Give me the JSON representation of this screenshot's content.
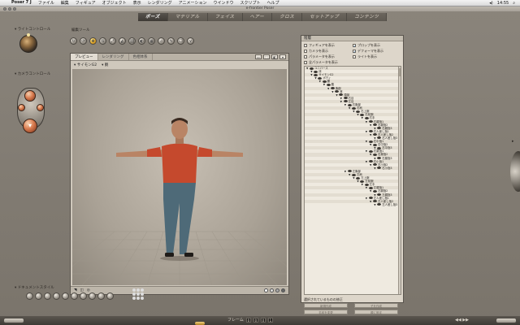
{
  "menubar": {
    "items": [
      "Poser 7 J",
      "ファイル",
      "編集",
      "フィギュア",
      "オブジェクト",
      "表示",
      "レンダリング",
      "アニメーション",
      "ウインドウ",
      "スクリプト",
      "ヘルプ"
    ],
    "time": "14:55"
  },
  "window": {
    "title": "e-frontier Poser"
  },
  "room_tabs": [
    "ポーズ",
    "マテリアル",
    "フェイス",
    "ヘアー",
    "クロス",
    "セットアップ",
    "コンテンツ"
  ],
  "left_panel": {
    "light_controls_label": "ライトコントロール",
    "camera_controls_label": "カメラコントロール",
    "document_display_label": "ドキュメントスタイル"
  },
  "editing_tools_label": "編集ツール",
  "document": {
    "tabs": [
      "プレビュー",
      "レンダリング",
      "色相体系"
    ],
    "figure_select": "サイモンG2",
    "body_part_select": "胴"
  },
  "hierarchy": {
    "title": "階層",
    "options": [
      {
        "label": "フィギュアを表示",
        "checked": false
      },
      {
        "label": "プロップを表示",
        "checked": true
      },
      {
        "label": "カメラを表示",
        "checked": false
      },
      {
        "label": "デフォーマを表示",
        "checked": true
      },
      {
        "label": "パラメータを表示",
        "checked": false
      },
      {
        "label": "ライトを表示",
        "checked": false
      },
      {
        "label": "全パラメータを表示",
        "checked": false
      }
    ],
    "tree": [
      {
        "label": "ユニバース",
        "depth": 0
      },
      {
        "label": "床",
        "depth": 1
      },
      {
        "label": "サイモンG2",
        "depth": 1
      },
      {
        "label": "ボディ",
        "depth": 2
      },
      {
        "label": "腰",
        "depth": 3
      },
      {
        "label": "腹",
        "depth": 4
      },
      {
        "label": "胸部",
        "depth": 5
      },
      {
        "label": "首",
        "depth": 6
      },
      {
        "label": "頭部",
        "depth": 7
      },
      {
        "label": "右目",
        "depth": 8
      },
      {
        "label": "左目",
        "depth": 8
      },
      {
        "label": "右胸部",
        "depth": 9
      },
      {
        "label": "右肩",
        "depth": 10
      },
      {
        "label": "右上腕",
        "depth": 11
      },
      {
        "label": "右前腕",
        "depth": 12
      },
      {
        "label": "右手",
        "depth": 13
      },
      {
        "label": "右親指1",
        "depth": 14
      },
      {
        "label": "右親指2",
        "depth": 15
      },
      {
        "label": "右親指3",
        "depth": 16
      },
      {
        "label": "右人差し指1",
        "depth": 14
      },
      {
        "label": "右人差し指2",
        "depth": 15
      },
      {
        "label": "右人差し指3",
        "depth": 16
      },
      {
        "label": "右中指1",
        "depth": 14
      },
      {
        "label": "右中指2",
        "depth": 15
      },
      {
        "label": "右中指3",
        "depth": 16
      },
      {
        "label": "右薬指1",
        "depth": 14
      },
      {
        "label": "右薬指2",
        "depth": 15
      },
      {
        "label": "右薬指3",
        "depth": 16
      },
      {
        "label": "右小指1",
        "depth": 14
      },
      {
        "label": "右小指2",
        "depth": 15
      },
      {
        "label": "右小指3",
        "depth": 16
      },
      {
        "label": "左胸部",
        "depth": 9
      },
      {
        "label": "左肩",
        "depth": 10
      },
      {
        "label": "左上腕",
        "depth": 11
      },
      {
        "label": "左前腕",
        "depth": 12
      },
      {
        "label": "左手",
        "depth": 13
      },
      {
        "label": "左親指1",
        "depth": 14
      },
      {
        "label": "左親指2",
        "depth": 15
      },
      {
        "label": "左親指3",
        "depth": 16
      },
      {
        "label": "左人差し指1",
        "depth": 14
      },
      {
        "label": "左人差し指2",
        "depth": 15
      },
      {
        "label": "左人差し指3",
        "depth": 16
      }
    ],
    "selected_label": "選択されているものの修正",
    "buttons": [
      "新規作成",
      "名前を変更",
      "子を作成",
      "親に設定"
    ]
  },
  "timeline": {
    "frame_label": "フレーム",
    "frame_digits": [
      "0",
      "0",
      "0",
      "1"
    ]
  },
  "colors": {
    "shirt": "#c5492d",
    "jeans": "#4e6a78",
    "skin": "#b98465",
    "active_tab_text": "#ffffff",
    "check": "#1a6bb8"
  }
}
